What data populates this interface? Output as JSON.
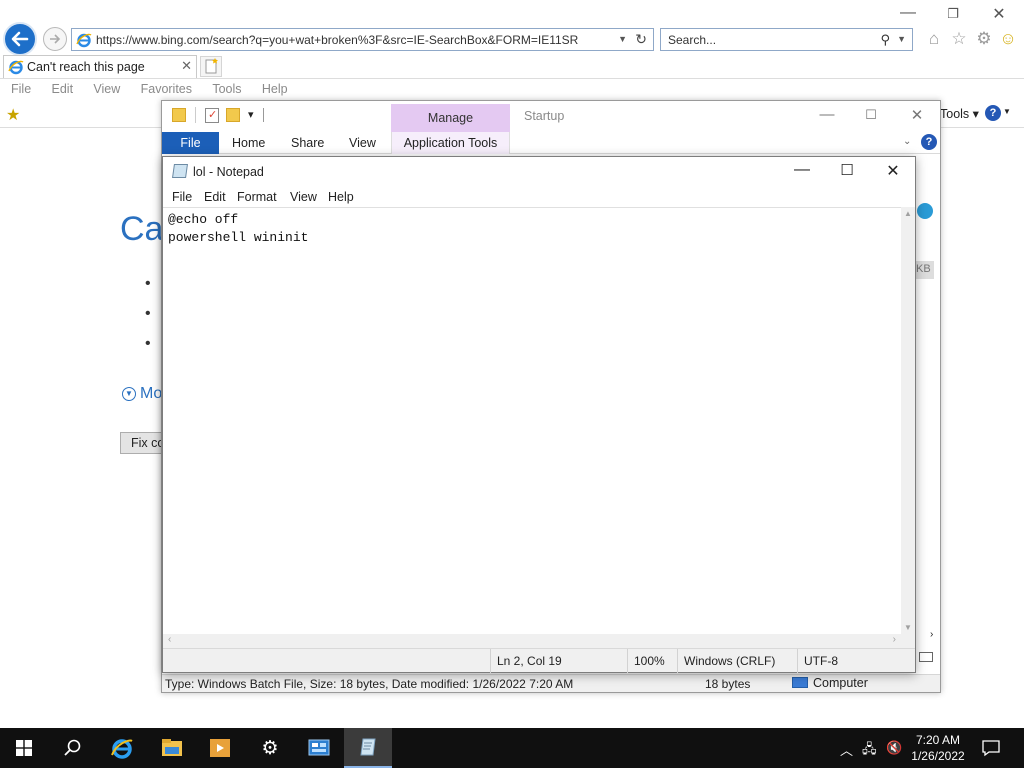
{
  "ie": {
    "address_url": "https://www.bing.com/search?q=you+wat+broken%3F&src=IE-SearchBox&FORM=IE11SR",
    "search_placeholder": "Search...",
    "tab_title": "Can't reach this page",
    "menu": [
      "File",
      "Edit",
      "View",
      "Favorites",
      "Tools",
      "Help"
    ],
    "tools_label": "Tools",
    "error_title": "Ca",
    "more_label": "Mo",
    "fix_button": "Fix co"
  },
  "explorer": {
    "manage_label": "Manage",
    "startup_label": "Startup",
    "tabs": {
      "file": "File",
      "home": "Home",
      "share": "Share",
      "view": "View",
      "app_tools": "Application Tools"
    },
    "status_text": "Type: Windows Batch File, Size: 18 bytes, Date modified: 1/26/2022 7:20 AM",
    "status_size": "18 bytes",
    "status_location": "Computer",
    "side_fragment": "KB"
  },
  "notepad": {
    "title": "lol - Notepad",
    "menu": {
      "file": "File",
      "edit": "Edit",
      "format": "Format",
      "view": "View",
      "help": "Help"
    },
    "content": "@echo off\npowershell wininit",
    "status": {
      "position": "Ln 2, Col 19",
      "zoom": "100%",
      "line_ending": "Windows (CRLF)",
      "encoding": "UTF-8"
    }
  },
  "taskbar": {
    "time": "7:20 AM",
    "date": "1/26/2022",
    "pinned": [
      "start-icon",
      "search-icon",
      "internet-explorer-icon",
      "file-explorer-icon",
      "media-player-icon",
      "settings-icon",
      "control-panel-icon",
      "notepad-icon"
    ]
  },
  "colors": {
    "ie_blue": "#1e6fc9",
    "link_blue": "#2b71c0",
    "file_tab": "#1c5fb8",
    "manage_band": "#e4c9f2",
    "taskbar": "#101010"
  }
}
